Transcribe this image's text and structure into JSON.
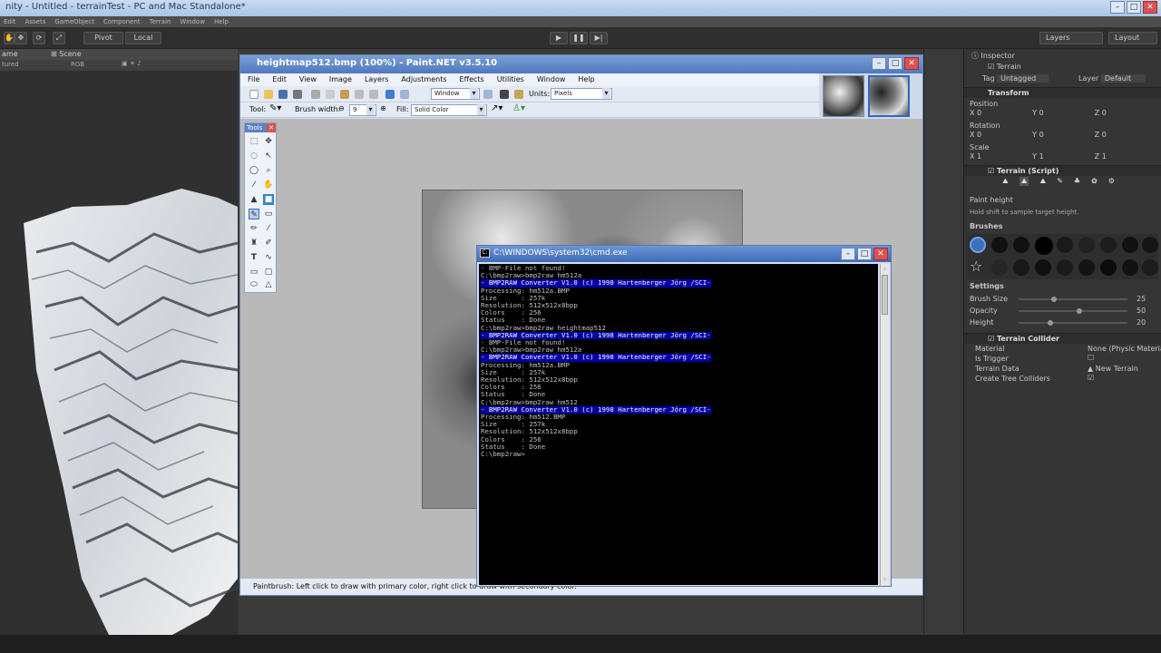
{
  "unity": {
    "title": "nity - Untitled - terrainTest - PC and Mac Standalone*",
    "menu": [
      "Edit",
      "Assets",
      "GameObject",
      "Component",
      "Terrain",
      "Window",
      "Help"
    ],
    "toolbar": {
      "pivot": "Pivot",
      "local": "Local",
      "layers": "Layers",
      "layout": "Layout"
    },
    "tabs": {
      "game": "ame",
      "scene": "Scene"
    },
    "scene_sub": {
      "mode": "tured",
      "rgb": "RGB"
    }
  },
  "inspector": {
    "tab": "Inspector",
    "object_name": "Terrain",
    "tag_label": "Tag",
    "tag_value": "Untagged",
    "layer_label": "Layer",
    "layer_value": "Default",
    "transform": "Transform",
    "position": "Position",
    "rotation": "Rotation",
    "scale": "Scale",
    "pos": [
      "0",
      "0",
      "0"
    ],
    "rot": [
      "0",
      "0",
      "0"
    ],
    "scl": [
      "1",
      "1",
      "1"
    ],
    "terrain_script": "Terrain (Script)",
    "paint_height": "Paint height",
    "hint": "Hold shift to sample target height.",
    "brushes": "Brushes",
    "settings": "Settings",
    "brush_size_label": "Brush Size",
    "brush_size": "25",
    "opacity_label": "Opacity",
    "opacity": "50",
    "height_label": "Height",
    "height": "20",
    "collider": "Terrain Collider",
    "material_label": "Material",
    "material_value": "None (Physic Materia",
    "is_trigger": "Is Trigger",
    "terrain_data_label": "Terrain Data",
    "terrain_data_value": "New Terrain",
    "tree_colliders": "Create Tree Colliders"
  },
  "pdn": {
    "title": "heightmap512.bmp (100%) - Paint.NET v3.5.10",
    "menu": [
      "File",
      "Edit",
      "View",
      "Image",
      "Layers",
      "Adjustments",
      "Effects",
      "Utilities",
      "Window",
      "Help"
    ],
    "window_combo": "Window",
    "units_label": "Units:",
    "units_value": "Pixels",
    "tool_label": "Tool:",
    "brush_width_label": "Brush width:",
    "brush_width": "9",
    "fill_label": "Fill:",
    "fill_value": "Solid Color",
    "tools_title": "Tools",
    "status": "Paintbrush: Left click to draw with primary color, right click to draw with secondary color."
  },
  "cmd": {
    "title": "C:\\WINDOWS\\system32\\cmd.exe",
    "lines": [
      {
        "t": "- BMP-File not found!",
        "hl": false
      },
      {
        "t": "C:\\bmp2raw>bmp2raw hm512a",
        "hl": false
      },
      {
        "t": "- BMP2RAW Converter V1.0 (c) 1998 Hartenberger Jörg /SCI-",
        "hl": true
      },
      {
        "t": "Processing: hm512a.BMP",
        "hl": false
      },
      {
        "t": "Size      : 257k",
        "hl": false
      },
      {
        "t": "Resolution: 512x512x8bpp",
        "hl": false
      },
      {
        "t": "Colors    : 256",
        "hl": false
      },
      {
        "t": "Status    : Done",
        "hl": false
      },
      {
        "t": "C:\\bmp2raw>bmp2raw heightmap512",
        "hl": false
      },
      {
        "t": "- BMP2RAW Converter V1.0 (c) 1998 Hartenberger Jörg /SCI-",
        "hl": true
      },
      {
        "t": "- BMP-File not found!",
        "hl": false
      },
      {
        "t": "C:\\bmp2raw>bmp2raw hm512a",
        "hl": false
      },
      {
        "t": "- BMP2RAW Converter V1.0 (c) 1998 Hartenberger Jörg /SCI-",
        "hl": true
      },
      {
        "t": "Processing: hm512a.BMP",
        "hl": false
      },
      {
        "t": "Size      : 257k",
        "hl": false
      },
      {
        "t": "Resolution: 512x512x8bpp",
        "hl": false
      },
      {
        "t": "Colors    : 256",
        "hl": false
      },
      {
        "t": "Status    : Done",
        "hl": false
      },
      {
        "t": "C:\\bmp2raw>bmp2raw hm512",
        "hl": false
      },
      {
        "t": "- BMP2RAW Converter V1.0 (c) 1998 Hartenberger Jörg /SCI-",
        "hl": true
      },
      {
        "t": "Processing: hm512.BMP",
        "hl": false
      },
      {
        "t": "Size      : 257k",
        "hl": false
      },
      {
        "t": "Resolution: 512x512x8bpp",
        "hl": false
      },
      {
        "t": "Colors    : 256",
        "hl": false
      },
      {
        "t": "Status    : Done",
        "hl": false
      },
      {
        "t": "C:\\bmp2raw>",
        "hl": false
      }
    ]
  }
}
